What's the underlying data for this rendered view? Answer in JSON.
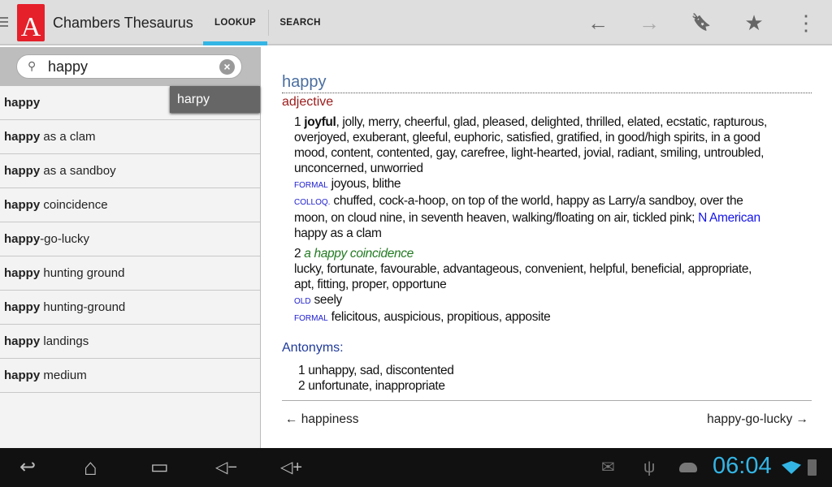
{
  "app": {
    "title": "Chambers Thesaurus",
    "logo_text": "A",
    "tabs": [
      "LOOKUP",
      "SEARCH"
    ]
  },
  "actions": {
    "back": "←",
    "forward": "→",
    "bookmark": "🔖",
    "star": "★",
    "overflow": "⋮"
  },
  "search": {
    "value": "happy",
    "placeholder": ""
  },
  "suggestion": "harpy",
  "list": [
    {
      "b": "happy",
      "r": ""
    },
    {
      "b": "happy",
      "r": " as a clam"
    },
    {
      "b": "happy",
      "r": " as a sandboy"
    },
    {
      "b": "happy",
      "r": " coincidence"
    },
    {
      "b": "happy",
      "r": "-go-lucky"
    },
    {
      "b": "happy",
      "r": " hunting ground"
    },
    {
      "b": "happy",
      "r": " hunting-ground"
    },
    {
      "b": "happy",
      "r": " landings"
    },
    {
      "b": "happy",
      "r": " medium"
    }
  ],
  "entry": {
    "headword": "happy",
    "pos": "adjective",
    "s1_num": "1",
    "s1_bold": "joyful",
    "s1_lines": [
      ", jolly, merry, cheerful, glad, pleased, delighted, thrilled, elated, ecstatic, rapturous,",
      "overjoyed, exuberant, gleeful, euphoric, satisfied, gratified, in good/high spirits, in a good",
      "mood, content, contented, gay, carefree, light-hearted, jovial, radiant, smiling, untroubled,",
      "unconcerned, unworried"
    ],
    "formal_label": "FORMAL",
    "s1_formal": " joyous, blithe",
    "colloq_label": "COLLOQ.",
    "s1_colloq": [
      " chuffed, cock-a-hoop, on top of the world, happy as Larry/a sandboy, over the",
      "moon, on cloud nine, in seventh heaven, walking/floating on air, tickled pink; ",
      "happy as a clam"
    ],
    "namerican": "N American",
    "s2_num": "2",
    "s2_example": "a happy coincidence",
    "s2_lines": [
      "lucky, fortunate, favourable, advantageous, convenient, helpful, beneficial, appropriate,",
      "apt, fitting, proper, opportune"
    ],
    "old_label": "OLD",
    "s2_old": " seely",
    "s2_formal": " felicitous, auspicious, propitious, apposite",
    "antonyms_title": "Antonyms:",
    "antonyms": [
      "1 unhappy, sad, discontented",
      "2 unfortunate, inappropriate"
    ],
    "prev": "← happiness",
    "next": "happy-go-lucky →"
  },
  "status": {
    "time": "06:04",
    "clock_color": "#33b5e5"
  },
  "nav": {
    "back": "↩",
    "home": "⌂",
    "recents": "▭",
    "vol_down": "◁−",
    "vol_up": "◁+"
  }
}
